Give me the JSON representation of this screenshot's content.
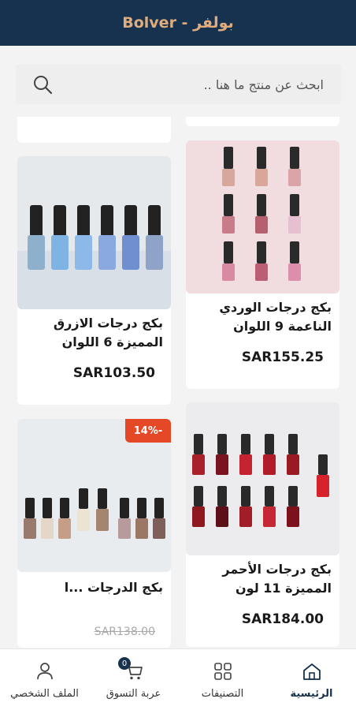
{
  "header": {
    "title": "Bolver - بولفر"
  },
  "search": {
    "placeholder": "ابحث عن منتج ما هنا .."
  },
  "products": [
    {
      "title": "بكج درجات الوردي الناعمة 9 اللوان",
      "price": "SAR155.25"
    },
    {
      "title": "بكج درجات الازرق المميزة 6 اللوان",
      "price": "SAR103.50"
    },
    {
      "title": "بكج درجات الأحمر المميزة 11 لون",
      "price": "SAR184.00"
    },
    {
      "title": "بكج الدرجات ...ا",
      "old_price": "SAR138.00",
      "badge": "14%-"
    }
  ],
  "nav": {
    "home": "الرئيسية",
    "categories": "التصنيفات",
    "cart": "عربة التسوق",
    "cart_count": "0",
    "profile": "الملف الشخصي"
  },
  "colors": {
    "header_bg": "#16324f",
    "brand_accent": "#e0ac7d",
    "badge": "#e54826"
  }
}
